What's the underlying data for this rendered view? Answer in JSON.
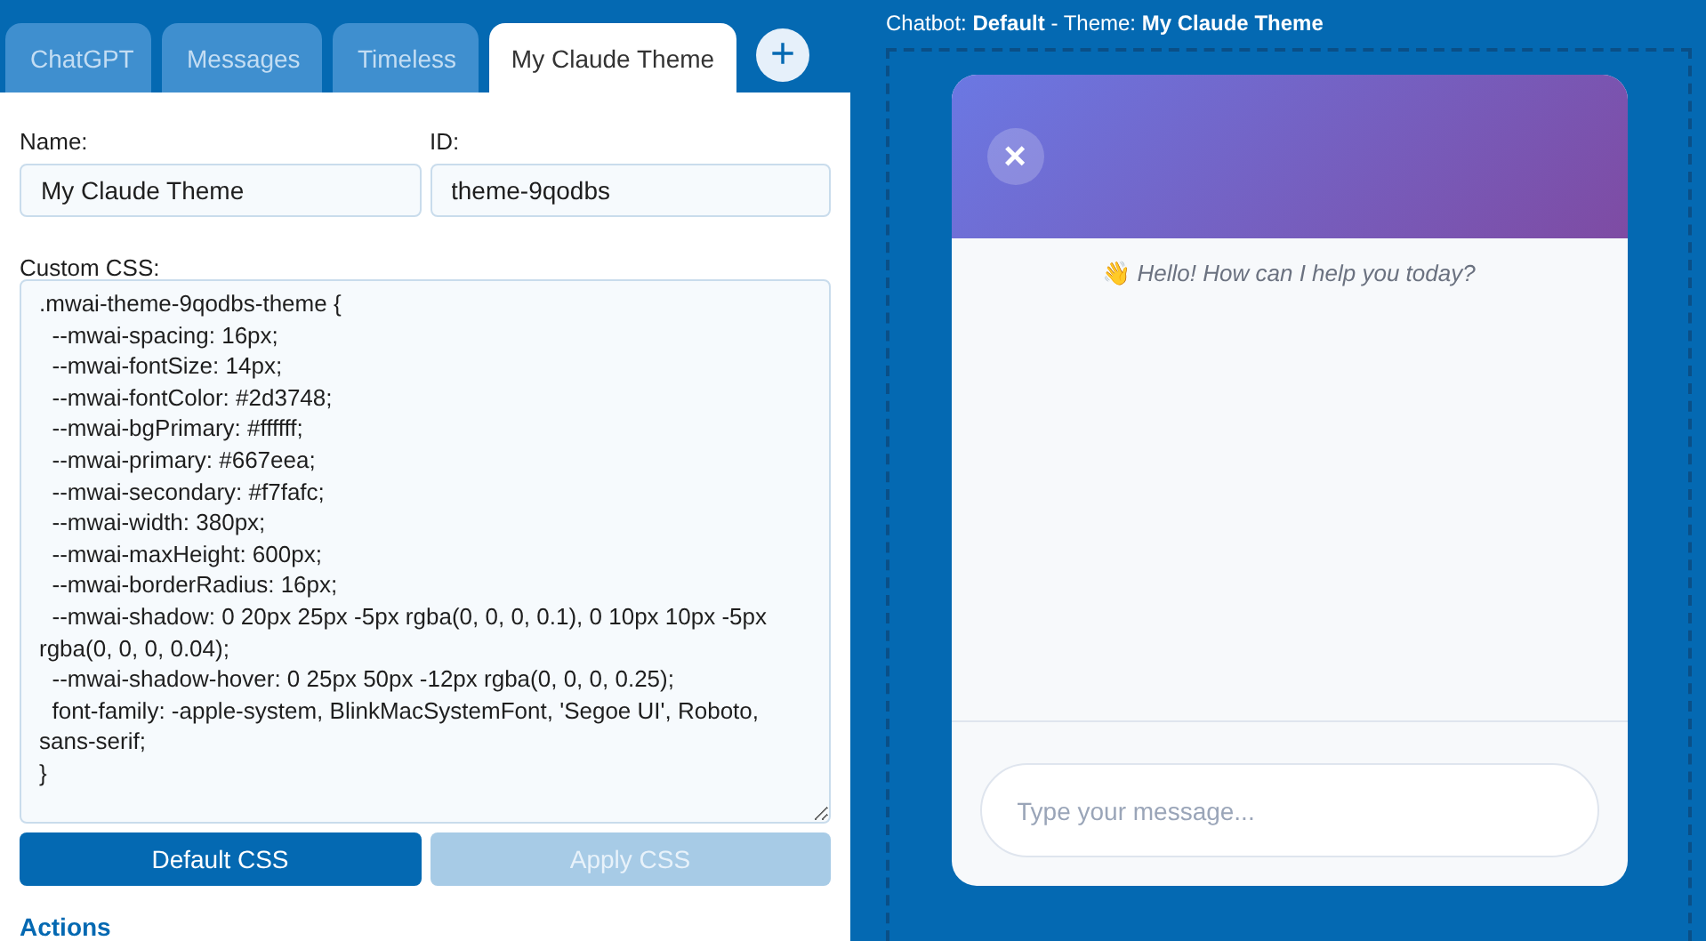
{
  "tabs": [
    {
      "label": "ChatGPT",
      "selected": false
    },
    {
      "label": "Messages",
      "selected": false
    },
    {
      "label": "Timeless",
      "selected": false
    },
    {
      "label": "My Claude Theme",
      "selected": true
    }
  ],
  "add_tab": "+",
  "form": {
    "name_label": "Name:",
    "name_value": "My Claude Theme",
    "id_label": "ID:",
    "id_value": "theme-9qodbs",
    "css_label": "Custom CSS:",
    "css_value": ".mwai-theme-9qodbs-theme {\n  --mwai-spacing: 16px;\n  --mwai-fontSize: 14px;\n  --mwai-fontColor: #2d3748;\n  --mwai-bgPrimary: #ffffff;\n  --mwai-primary: #667eea;\n  --mwai-secondary: #f7fafc;\n  --mwai-width: 380px;\n  --mwai-maxHeight: 600px;\n  --mwai-borderRadius: 16px;\n  --mwai-shadow: 0 20px 25px -5px rgba(0, 0, 0, 0.1), 0 10px 10px -5px rgba(0, 0, 0, 0.04);\n  --mwai-shadow-hover: 0 25px 50px -12px rgba(0, 0, 0, 0.25);\n  font-family: -apple-system, BlinkMacSystemFont, 'Segoe UI', Roboto, sans-serif;\n}",
    "buttons": [
      {
        "label": "Default CSS",
        "disabled": false
      },
      {
        "label": "Apply CSS",
        "disabled": true
      }
    ],
    "section_title": "Actions"
  },
  "preview": {
    "caption": "Chatbot: **Default** - Theme: **My Claude Theme**",
    "close": "×",
    "greeting_emoji": "👋",
    "greeting": "Hello! How can I help you today?",
    "input": {
      "placeholder": "Type your message..."
    }
  }
}
